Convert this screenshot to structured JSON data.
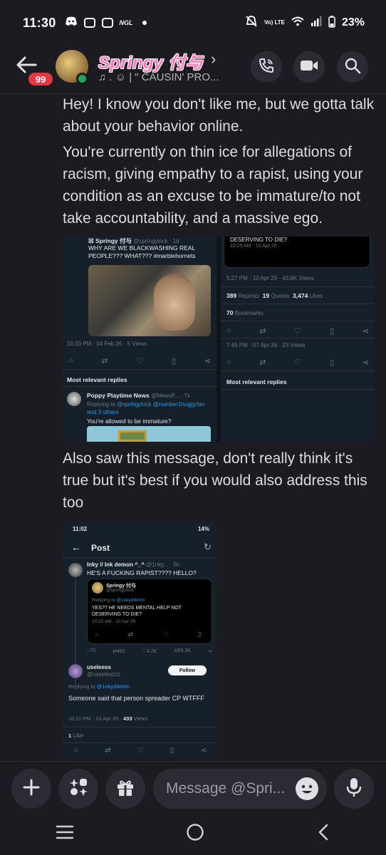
{
  "status_bar": {
    "time": "11:30",
    "ngl": "NGL",
    "volte": "Vo) LTE",
    "battery": "23%"
  },
  "header": {
    "unread_badge": "99",
    "user_name": "Springy 付与",
    "status_text": "♫ . ☺︎  |  \" CAUSIN' PRO...",
    "colors": {
      "name": "#ff7ab8",
      "online": "#23a559",
      "badge": "#e5383f"
    }
  },
  "messages": {
    "m1": "Hey! I know you don't like me, but we gotta talk about your behavior online.",
    "m2": "You're currently on thin ice for allegations of racism, giving empathy to a rapist, using your condition as an excuse to be immature/to not take accountability, and a massive ego.",
    "m3": "Also saw this message, don't really think it's true but it's best if you would also address this too"
  },
  "embed1": {
    "left": {
      "author": "☒ Springy 付与",
      "handle": "@springylock · 1d",
      "text": "WHY ARE WE BLACKWASHING REAL PEOPLE??? WHAT??? #marblehornets",
      "meta": "10:33 PM · 04 Feb 26 · 5 Views",
      "most_relevant": "Most relevant replies",
      "reply_author": "Poppy Playtime News",
      "reply_handle": "@NewsP... · 7s",
      "reply_to_prefix": "Replying to ",
      "reply_to": "@springylock @number1huggyfan and 3 others",
      "reply_text": "You're allowed to be immature?"
    },
    "right": {
      "top_text": "DESERVING TO DIE?",
      "top_meta": "10:25 AM · 10 Apr 26",
      "meta": "5:27 PM · 10 Apr 26 · 43.8K Views",
      "reposts": "389",
      "reposts_label": "Reposts",
      "quotes": "19",
      "quotes_label": "Quotes",
      "likes": "3,474",
      "likes_label": "Likes",
      "bookmarks": "70",
      "bookmarks_label": "Bookmarks",
      "meta2": "7:45 PM · 07 Apr 26 · 23 Views",
      "most_relevant": "Most relevant replies"
    }
  },
  "embed2": {
    "status_time": "11:02",
    "status_batt": "14%",
    "title": "Post",
    "author": "Inky // Ink demon ^_^",
    "handle": "@1nky... · 5h",
    "text": "HE'S A FUCKING RAPIST???? HELLO?",
    "quoted_name": "Springy 付与",
    "quoted_handle": "@springylock",
    "quoted_reply_prefix": "Replying to ",
    "quoted_reply_handle": "@1nkyd3m0n",
    "quoted_text": "YES?? HE NEEDS MENTAL HELP NOT DESERVING TO DIE?",
    "quoted_meta": "10:25 AM · 10 Apr 26",
    "stats": {
      "replies": "70",
      "reposts": "481",
      "likes": "4.2K",
      "views": "55.3K"
    },
    "reply_name": "useleess",
    "reply_handle": "@usseleszzz",
    "follow": "Follow",
    "reply_to_prefix": "Replying to ",
    "reply_to": "@1nkyd3m0n",
    "reply_text": "Someone said that person spreader CP WTFFF",
    "reply_meta": "10:11 PM · 10 Apr 26 · ",
    "reply_views": "433",
    "reply_views_label": " Views",
    "likes_count": "1",
    "likes_label": " Like"
  },
  "composer": {
    "placeholder": "Message @Spri..."
  },
  "icons": [
    "back-arrow-icon",
    "phone-icon",
    "video-icon",
    "search-icon",
    "plus-icon",
    "apps-icon",
    "gift-icon",
    "emoji-icon",
    "microphone-icon",
    "nav-recents-icon",
    "nav-home-icon",
    "nav-back-icon"
  ]
}
